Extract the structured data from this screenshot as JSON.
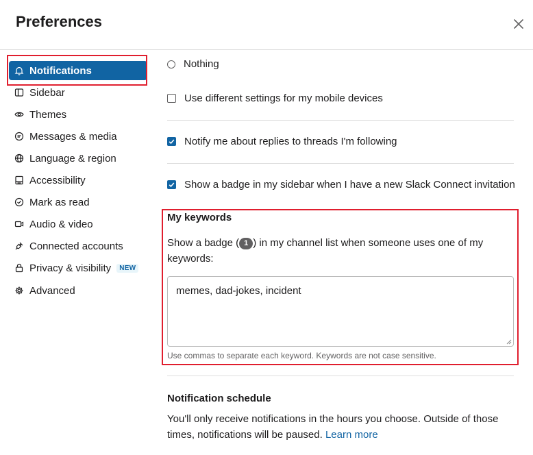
{
  "header": {
    "title": "Preferences"
  },
  "sidebar": {
    "items": [
      {
        "label": "Notifications",
        "icon": "bell-icon"
      },
      {
        "label": "Sidebar",
        "icon": "sidebar-icon"
      },
      {
        "label": "Themes",
        "icon": "eye-icon"
      },
      {
        "label": "Messages & media",
        "icon": "message-icon"
      },
      {
        "label": "Language & region",
        "icon": "globe-icon"
      },
      {
        "label": "Accessibility",
        "icon": "keyboard-icon"
      },
      {
        "label": "Mark as read",
        "icon": "check-circle-icon"
      },
      {
        "label": "Audio & video",
        "icon": "video-icon"
      },
      {
        "label": "Connected accounts",
        "icon": "plug-icon"
      },
      {
        "label": "Privacy & visibility",
        "icon": "lock-icon",
        "badge": "NEW"
      },
      {
        "label": "Advanced",
        "icon": "gear-icon"
      }
    ],
    "active_index": 0
  },
  "content": {
    "radio_nothing": {
      "label": "Nothing",
      "checked": false
    },
    "mobile_settings": {
      "label": "Use different settings for my mobile devices",
      "checked": false
    },
    "thread_replies": {
      "label": "Notify me about replies to threads I'm following",
      "checked": true
    },
    "slack_connect": {
      "label": "Show a badge in my sidebar when I have a new Slack Connect invitation",
      "checked": true
    },
    "keywords": {
      "title": "My keywords",
      "desc_before": "Show a badge (",
      "badge_value": "1",
      "desc_after": ") in my channel list when someone uses one of my keywords:",
      "value": "memes, dad-jokes, incident",
      "hint": "Use commas to separate each keyword. Keywords are not case sensitive."
    },
    "schedule": {
      "title": "Notification schedule",
      "desc": "You'll only receive notifications in the hours you choose. Outside of those times, notifications will be paused.",
      "link": "Learn more"
    }
  },
  "colors": {
    "accent": "#1164a3",
    "highlight_box": "#e01e2e",
    "link": "#1264a3"
  }
}
